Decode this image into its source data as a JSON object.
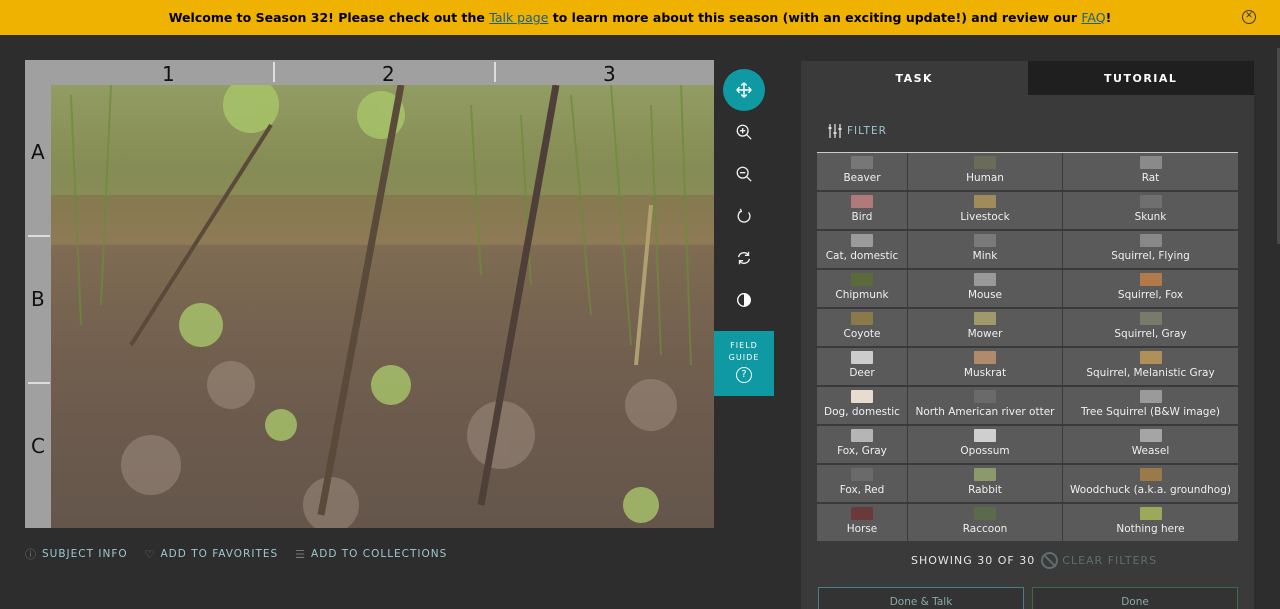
{
  "banner": {
    "text_before": "Welcome to Season 32! Please check out the ",
    "talk_link": "Talk page",
    "text_middle": " to learn more about this season (with an exciting update!) and review our ",
    "faq_link": "FAQ",
    "text_after": "!",
    "close_icon": "close-circle-icon"
  },
  "viewer": {
    "columns": [
      "1",
      "2",
      "3"
    ],
    "rows": [
      "A",
      "B",
      "C"
    ]
  },
  "toolbar": {
    "tools": [
      "move-icon",
      "zoom-in-icon",
      "zoom-out-icon",
      "rotate-icon",
      "reset-icon",
      "invert-icon"
    ],
    "field_guide_line1": "FIELD",
    "field_guide_line2": "GUIDE",
    "field_guide_icon": "?"
  },
  "meta": {
    "subject_info": "SUBJECT INFO",
    "add_favorites": "ADD TO FAVORITES",
    "add_collections": "ADD TO COLLECTIONS"
  },
  "panel": {
    "tab_task": "TASK",
    "tab_tutorial": "TUTORIAL",
    "filter_label": "FILTER",
    "species": [
      {
        "name": "Beaver",
        "color": "#777777"
      },
      {
        "name": "Human",
        "color": "#6b6b5a"
      },
      {
        "name": "Rat",
        "color": "#8a8a8a"
      },
      {
        "name": "Bird",
        "color": "#b07a7a"
      },
      {
        "name": "Livestock",
        "color": "#a08b5a"
      },
      {
        "name": "Skunk",
        "color": "#6f6f6f"
      },
      {
        "name": "Cat, domestic",
        "color": "#9a9a9a"
      },
      {
        "name": "Mink",
        "color": "#7a7a7a"
      },
      {
        "name": "Squirrel, Flying",
        "color": "#888888"
      },
      {
        "name": "Chipmunk",
        "color": "#5a6a3a"
      },
      {
        "name": "Mouse",
        "color": "#999999"
      },
      {
        "name": "Squirrel, Fox",
        "color": "#b07a4a"
      },
      {
        "name": "Coyote",
        "color": "#8a7a4a"
      },
      {
        "name": "Mower",
        "color": "#a09a6a"
      },
      {
        "name": "Squirrel, Gray",
        "color": "#7a7a6a"
      },
      {
        "name": "Deer",
        "color": "#cccccc"
      },
      {
        "name": "Muskrat",
        "color": "#b08a6a"
      },
      {
        "name": "Squirrel, Melanistic Gray",
        "color": "#b0905a"
      },
      {
        "name": "Dog, domestic",
        "color": "#e8dcd0"
      },
      {
        "name": "North American river otter",
        "color": "#6a6a6a"
      },
      {
        "name": "Tree Squirrel (B&W image)",
        "color": "#9a9a9a"
      },
      {
        "name": "Fox, Gray",
        "color": "#b5b5b5"
      },
      {
        "name": "Opossum",
        "color": "#cfcfcf"
      },
      {
        "name": "Weasel",
        "color": "#a5a5a5"
      },
      {
        "name": "Fox, Red",
        "color": "#6a6a6a"
      },
      {
        "name": "Rabbit",
        "color": "#8a9a6a"
      },
      {
        "name": "Woodchuck (a.k.a. groundhog)",
        "color": "#9a7a4a"
      },
      {
        "name": "Horse",
        "color": "#6a3a3a"
      },
      {
        "name": "Raccoon",
        "color": "#5a6a4a"
      },
      {
        "name": "Nothing here",
        "color": "#9aaa5a"
      }
    ],
    "showing": "SHOWING 30 OF 30",
    "clear_filters": "CLEAR FILTERS",
    "done_talk": "Done & Talk",
    "done": "Done"
  }
}
